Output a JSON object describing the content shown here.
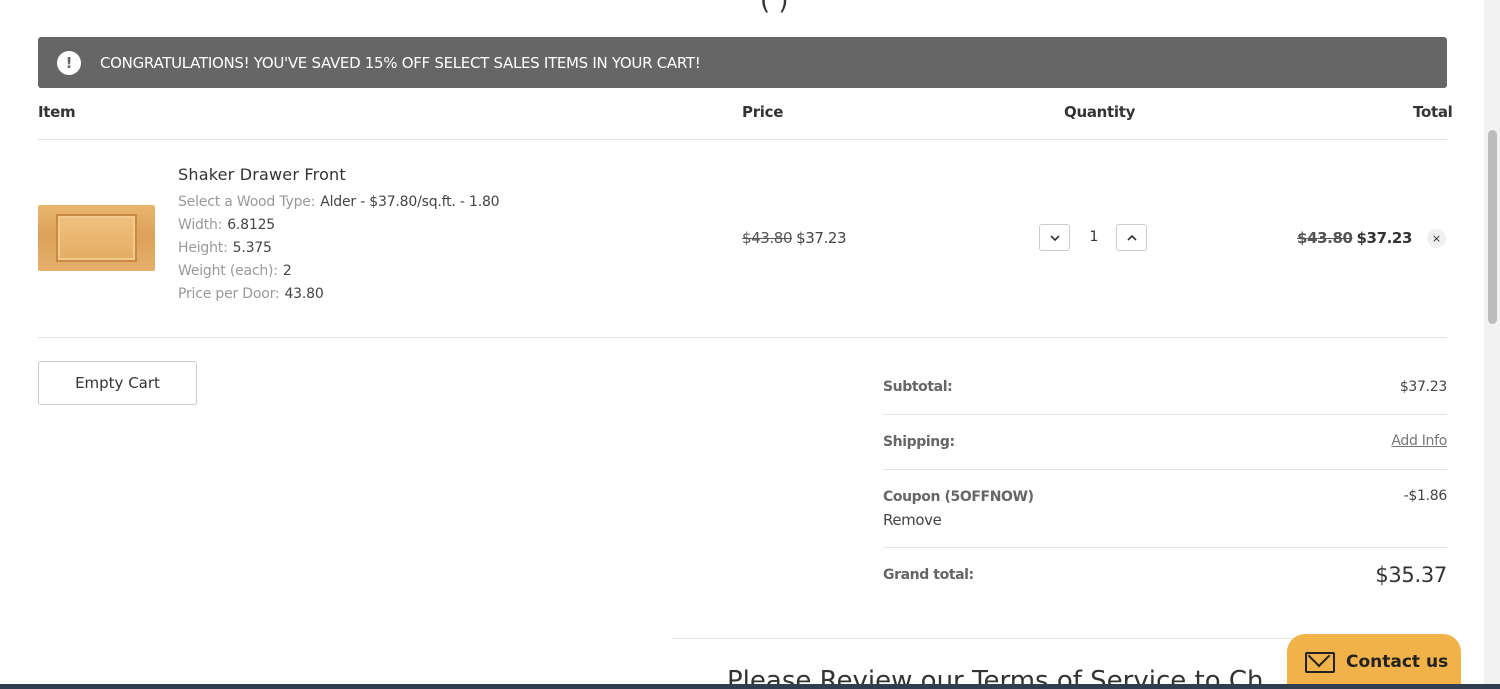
{
  "top_clip": "(    )",
  "alert": {
    "icon": "exclamation-icon",
    "text": "CONGRATULATIONS! YOU'VE SAVED 15% OFF SELECT SALES ITEMS IN YOUR CART!"
  },
  "table_headers": {
    "item": "Item",
    "price": "Price",
    "quantity": "Quantity",
    "total": "Total"
  },
  "cart_item": {
    "name": "Shaker Drawer Front",
    "options": [
      {
        "label": "Select a Wood Type:",
        "value": "Alder - $37.80/sq.ft. - 1.80"
      },
      {
        "label": "Width:",
        "value": "6.8125"
      },
      {
        "label": "Height:",
        "value": "5.375"
      },
      {
        "label": "Weight (each):",
        "value": "2"
      },
      {
        "label": "Price per Door:",
        "value": "43.80"
      }
    ],
    "price_old": "$43.80",
    "price_new": "$37.23",
    "quantity": "1",
    "total_old": "$43.80",
    "total_new": "$37.23",
    "remove_symbol": "×"
  },
  "empty_cart_label": "Empty Cart",
  "summary": {
    "subtotal_label": "Subtotal:",
    "subtotal_value": "$37.23",
    "shipping_label": "Shipping:",
    "shipping_value": "Add Info",
    "coupon_label": "Coupon (5OFFNOW)",
    "coupon_remove": "Remove",
    "coupon_value": "-$1.86",
    "grand_label": "Grand total:",
    "grand_value": "$35.37"
  },
  "tos_heading": "Please Review our Terms of Service to Ch",
  "contact_label": "Contact us"
}
